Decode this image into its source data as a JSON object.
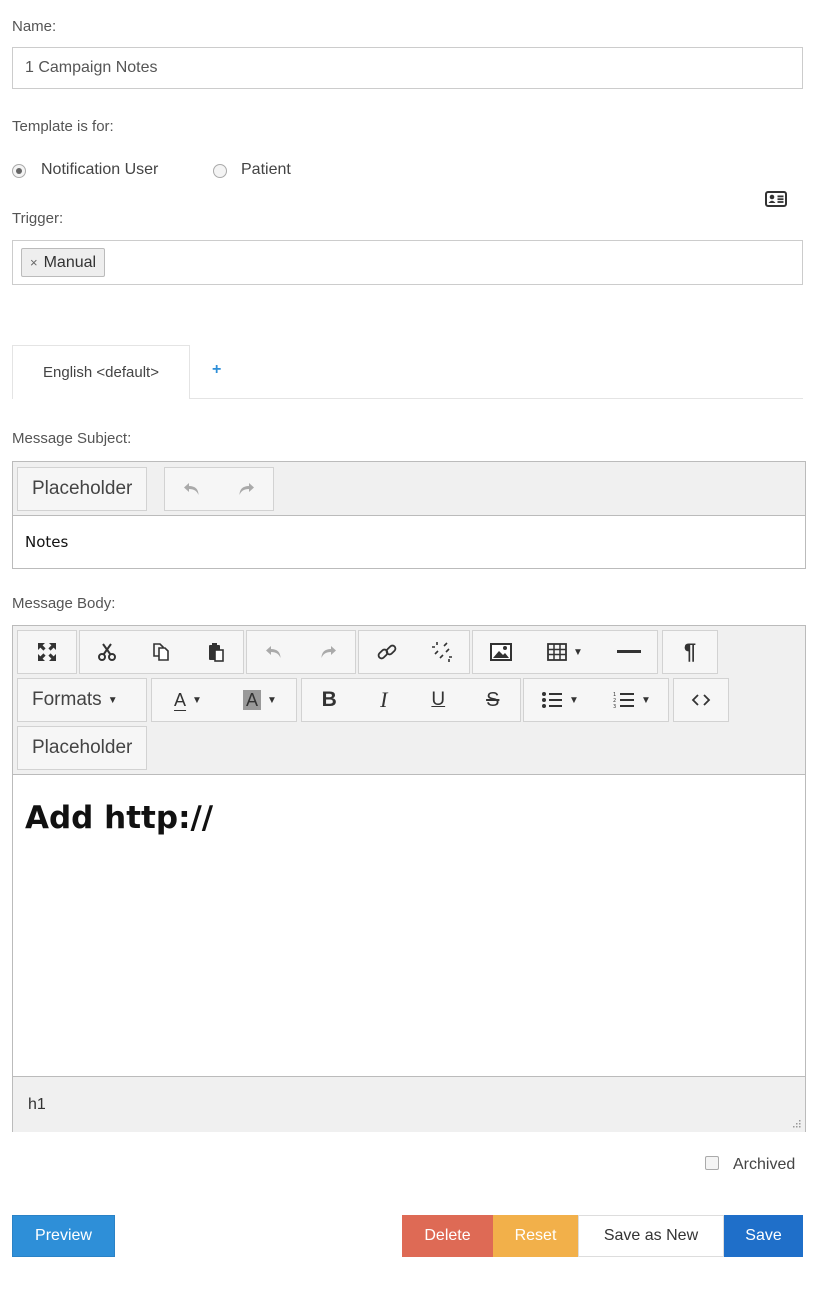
{
  "form": {
    "name_label": "Name:",
    "name_value": "1 Campaign Notes",
    "template_label": "Template is for:",
    "radio_options": [
      {
        "label": "Notification User",
        "selected": true
      },
      {
        "label": "Patient",
        "selected": false
      }
    ],
    "trigger_label": "Trigger:",
    "trigger_tags": [
      "Manual"
    ],
    "trigger_tag_remove": "×"
  },
  "tabs": {
    "items": [
      {
        "label": "English <default>",
        "active": true
      }
    ],
    "add_label": "+"
  },
  "subject": {
    "label": "Message Subject:",
    "toolbar_placeholder": "Placeholder",
    "value": "Notes"
  },
  "body": {
    "label": "Message Body:",
    "formats_label": "Formats",
    "toolbar_placeholder": "Placeholder",
    "content_heading": "Add http://",
    "status_path": "h1"
  },
  "archived_label": "Archived",
  "buttons": {
    "preview": "Preview",
    "delete": "Delete",
    "reset": "Reset",
    "save_as_new": "Save as New",
    "save": "Save"
  },
  "colors": {
    "preview": "#2e8fd8",
    "delete": "#de6a55",
    "reset": "#f2b04a",
    "save": "#1f6fc9",
    "link": "#2e8fd8"
  },
  "icons": {
    "contact_card": "contact-card-icon"
  }
}
